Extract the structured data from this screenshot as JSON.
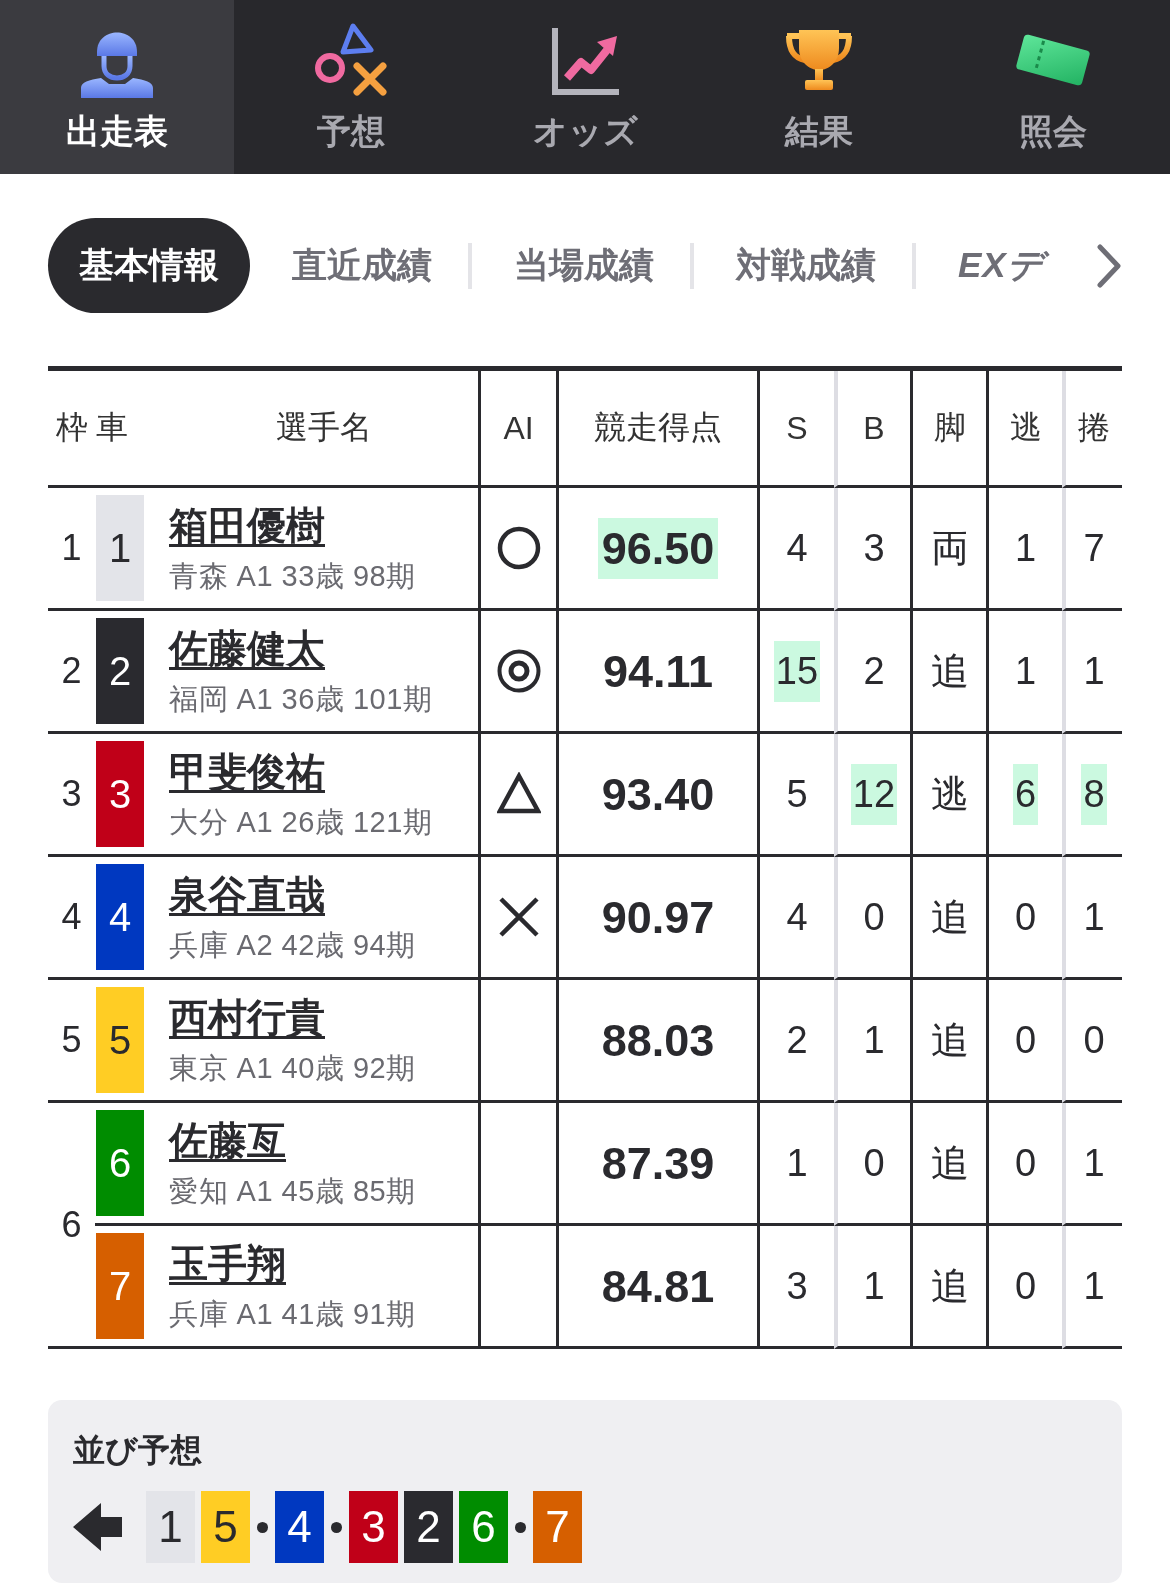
{
  "nav_tabs": [
    {
      "label": "出走表",
      "selected": true
    },
    {
      "label": "予想",
      "selected": false
    },
    {
      "label": "オッズ",
      "selected": false
    },
    {
      "label": "結果",
      "selected": false
    },
    {
      "label": "照会",
      "selected": false
    }
  ],
  "info_tabs": [
    {
      "label": "基本情報",
      "selected": true,
      "kind": "label"
    },
    {
      "label": "直近成績",
      "selected": false,
      "kind": "label"
    },
    {
      "label": "当場成績",
      "selected": false,
      "kind": "label"
    },
    {
      "label": "対戦成績",
      "selected": false,
      "kind": "label"
    },
    {
      "label": "EXデ",
      "selected": false,
      "kind": "logo"
    }
  ],
  "table": {
    "columns": [
      "枠",
      "車",
      "選手名",
      "AI",
      "競走得点",
      "S",
      "B",
      "脚",
      "逃",
      "捲"
    ],
    "frames": [
      {
        "frame": "1",
        "cars": [
          {
            "car": "1",
            "color": "#e3e4e9",
            "name": "箱田優樹",
            "info": "青森 A1 33歳 98期",
            "ai_mark": {
              "kind": "circle"
            },
            "score": {
              "value": "96.50",
              "highlighted": true
            },
            "stats": [
              {
                "value": "4",
                "highlighted": false
              },
              {
                "value": "3",
                "highlighted": false
              },
              {
                "value": "両",
                "highlighted": false
              },
              {
                "value": "1",
                "highlighted": false
              },
              {
                "value": "7",
                "highlighted": false
              }
            ]
          }
        ]
      },
      {
        "frame": "2",
        "cars": [
          {
            "car": "2",
            "color": "#2a2a2f",
            "name": "佐藤健太",
            "info": "福岡 A1 36歳 101期",
            "ai_mark": {
              "kind": "double_circle"
            },
            "score": {
              "value": "94.11",
              "highlighted": false
            },
            "stats": [
              {
                "value": "15",
                "highlighted": true
              },
              {
                "value": "2",
                "highlighted": false
              },
              {
                "value": "追",
                "highlighted": false
              },
              {
                "value": "1",
                "highlighted": false
              },
              {
                "value": "1",
                "highlighted": false
              }
            ]
          }
        ]
      },
      {
        "frame": "3",
        "cars": [
          {
            "car": "3",
            "color": "#c00018",
            "name": "甲斐俊祐",
            "info": "大分 A1 26歳 121期",
            "ai_mark": {
              "kind": "triangle"
            },
            "score": {
              "value": "93.40",
              "highlighted": false
            },
            "stats": [
              {
                "value": "5",
                "highlighted": false
              },
              {
                "value": "12",
                "highlighted": true
              },
              {
                "value": "逃",
                "highlighted": false
              },
              {
                "value": "6",
                "highlighted": true
              },
              {
                "value": "8",
                "highlighted": true
              }
            ]
          }
        ]
      },
      {
        "frame": "4",
        "cars": [
          {
            "car": "4",
            "color": "#0038c0",
            "name": "泉谷直哉",
            "info": "兵庫 A2 42歳 94期",
            "ai_mark": {
              "kind": "cross"
            },
            "score": {
              "value": "90.97",
              "highlighted": false
            },
            "stats": [
              {
                "value": "4",
                "highlighted": false
              },
              {
                "value": "0",
                "highlighted": false
              },
              {
                "value": "追",
                "highlighted": false
              },
              {
                "value": "0",
                "highlighted": false
              },
              {
                "value": "1",
                "highlighted": false
              }
            ]
          }
        ]
      },
      {
        "frame": "5",
        "cars": [
          {
            "car": "5",
            "color": "#ffcd24",
            "name": "西村行貴",
            "info": "東京 A1 40歳 92期",
            "score": {
              "value": "88.03",
              "highlighted": false
            },
            "stats": [
              {
                "value": "2",
                "highlighted": false
              },
              {
                "value": "1",
                "highlighted": false
              },
              {
                "value": "追",
                "highlighted": false
              },
              {
                "value": "0",
                "highlighted": false
              },
              {
                "value": "0",
                "highlighted": false
              }
            ]
          }
        ]
      },
      {
        "frame": "6",
        "cars": [
          {
            "car": "6",
            "color": "#008c00",
            "name": "佐藤亙",
            "info": "愛知 A1 45歳 85期",
            "score": {
              "value": "87.39",
              "highlighted": false
            },
            "stats": [
              {
                "value": "1",
                "highlighted": false
              },
              {
                "value": "0",
                "highlighted": false
              },
              {
                "value": "追",
                "highlighted": false
              },
              {
                "value": "0",
                "highlighted": false
              },
              {
                "value": "1",
                "highlighted": false
              }
            ]
          },
          {
            "car": "7",
            "color": "#d65f00",
            "name": "玉手翔",
            "info": "兵庫 A1 41歳 91期",
            "score": {
              "value": "84.81",
              "highlighted": false
            },
            "stats": [
              {
                "value": "3",
                "highlighted": false
              },
              {
                "value": "1",
                "highlighted": false
              },
              {
                "value": "追",
                "highlighted": false
              },
              {
                "value": "0",
                "highlighted": false
              },
              {
                "value": "1",
                "highlighted": false
              }
            ]
          }
        ]
      }
    ]
  },
  "lineup": {
    "title": "並び予想",
    "groups": [
      [
        {
          "car": "1",
          "color": "#e3e4e9"
        },
        {
          "car": "5",
          "color": "#ffcd24"
        }
      ],
      [
        {
          "car": "4",
          "color": "#0038c0"
        }
      ],
      [
        {
          "car": "3",
          "color": "#c00018"
        },
        {
          "car": "2",
          "color": "#2a2a2f"
        },
        {
          "car": "6",
          "color": "#008c00"
        }
      ],
      [
        {
          "car": "7",
          "color": "#d65f00"
        }
      ]
    ]
  }
}
